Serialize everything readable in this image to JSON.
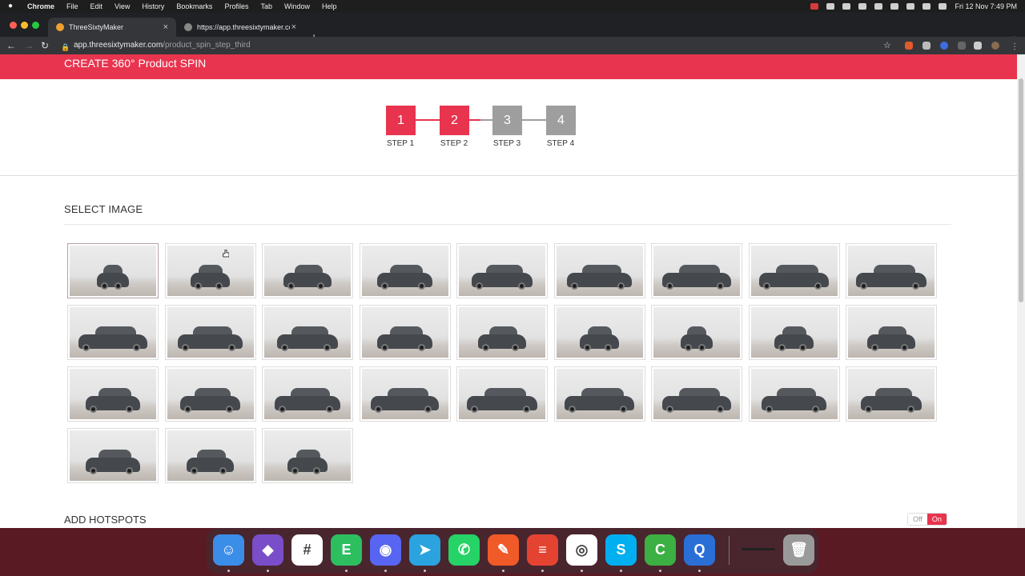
{
  "menubar": {
    "app": "Chrome",
    "items": [
      "File",
      "Edit",
      "View",
      "History",
      "Bookmarks",
      "Profiles",
      "Tab",
      "Window",
      "Help"
    ],
    "clock": "Fri 12 Nov  7:49 PM"
  },
  "tabs": [
    {
      "title": "ThreeSixtyMaker",
      "close": "×"
    },
    {
      "title": "https://app.threesixtymaker.co",
      "close": "×"
    }
  ],
  "newtab": "+",
  "address": {
    "host": "app.threesixtymaker.com",
    "path": "/product_spin_step_third"
  },
  "page": {
    "header": "CREATE 360° Product SPIN",
    "steps": [
      {
        "num": "1",
        "label": "STEP 1",
        "color": "#e8344e"
      },
      {
        "num": "2",
        "label": "STEP 2",
        "color": "#e8344e"
      },
      {
        "num": "3",
        "label": "STEP 3",
        "color": "#9e9e9e"
      },
      {
        "num": "4",
        "label": "STEP 4",
        "color": "#9e9e9e"
      }
    ],
    "select_image": "SELECT IMAGE",
    "image_count": 30,
    "add_hotspots": "ADD HOTSPOTS",
    "toggle": {
      "off": "Off",
      "on": "On"
    }
  },
  "colors": {
    "accent": "#e8344e",
    "inactive_step": "#9e9e9e"
  },
  "dock": [
    {
      "name": "finder-icon",
      "color": "#3b8ee8",
      "glyph": "☺"
    },
    {
      "name": "obsidian-icon",
      "color": "#7a4ec8",
      "glyph": "◆"
    },
    {
      "name": "slack-icon",
      "color": "#ffffff",
      "glyph": "#"
    },
    {
      "name": "evernote-icon",
      "color": "#2dbe60",
      "glyph": "E"
    },
    {
      "name": "discord-icon",
      "color": "#5865f2",
      "glyph": "◉"
    },
    {
      "name": "telegram-icon",
      "color": "#2aa3df",
      "glyph": "➤"
    },
    {
      "name": "whatsapp-icon",
      "color": "#25d366",
      "glyph": "✆"
    },
    {
      "name": "pen-app-icon",
      "color": "#f05a28",
      "glyph": "✎"
    },
    {
      "name": "todoist-icon",
      "color": "#e44332",
      "glyph": "≡"
    },
    {
      "name": "chrome-icon",
      "color": "#ffffff",
      "glyph": "◎"
    },
    {
      "name": "skype-icon",
      "color": "#00aff0",
      "glyph": "S"
    },
    {
      "name": "camtasia-icon",
      "color": "#3cb043",
      "glyph": "C"
    },
    {
      "name": "quicktime-icon",
      "color": "#2a6fd6",
      "glyph": "Q"
    },
    {
      "name": "trash-icon",
      "color": "#9a9a9a",
      "glyph": "🗑"
    }
  ]
}
